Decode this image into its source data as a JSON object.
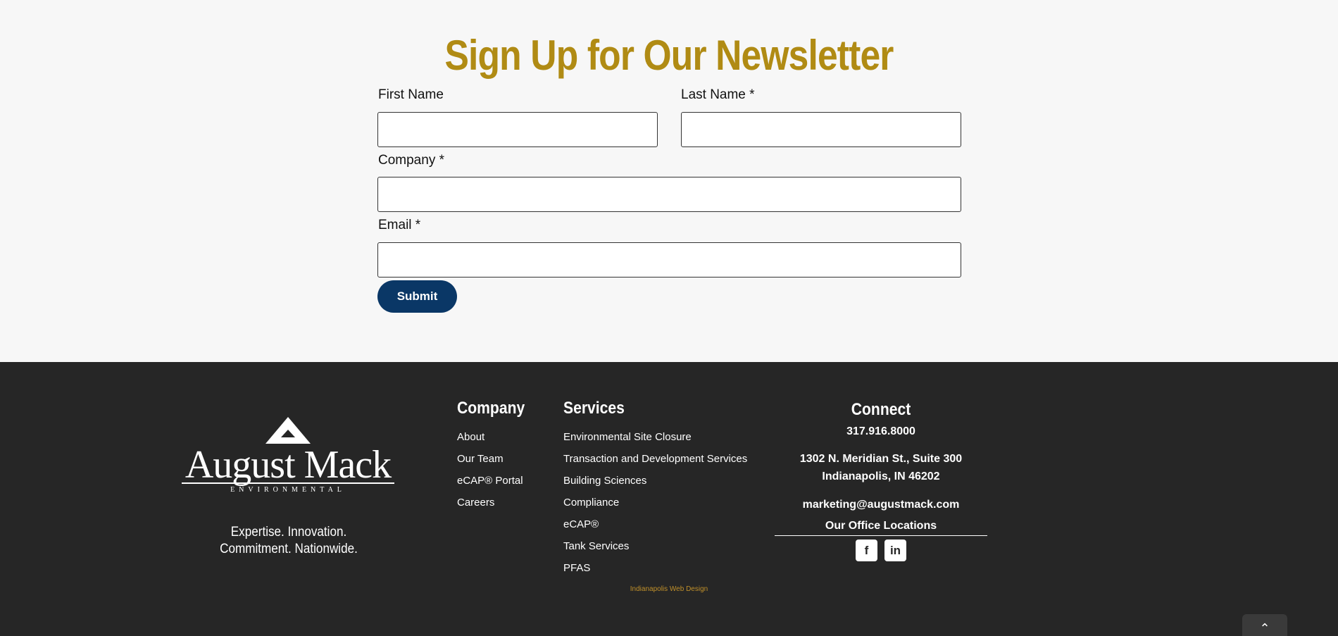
{
  "newsletter": {
    "title": "Sign Up for Our Newsletter",
    "first_name_label": "First Name",
    "last_name_label": "Last Name *",
    "company_label": "Company *",
    "email_label": "Email *",
    "first_name_value": "",
    "last_name_value": "",
    "company_value": "",
    "email_value": "",
    "submit_label": "Submit",
    "title_color": "#b08b14",
    "button_color": "#0a3766"
  },
  "footer": {
    "logo": {
      "name": "August Mack",
      "sub": "ENVIRONMENTAL"
    },
    "tagline_line1": "Expertise. Innovation.",
    "tagline_line2": "Commitment. Nationwide.",
    "company": {
      "heading": "Company",
      "items": [
        "About",
        "Our Team",
        "eCAP® Portal",
        "Careers"
      ]
    },
    "services": {
      "heading": "Services",
      "items": [
        "Environmental Site Closure",
        "Transaction and Development Services",
        "Building Sciences",
        "Compliance",
        "eCAP®",
        "Tank Services",
        "PFAS"
      ]
    },
    "connect": {
      "heading": "Connect",
      "phone": "317.916.8000",
      "address_line1": "1302 N. Meridian St., Suite 300",
      "address_line2": "Indianapolis, IN 46202",
      "email": "marketing@augustmack.com",
      "office_link": "Our Office Locations",
      "social": [
        {
          "icon": "facebook-icon",
          "glyph": "f"
        },
        {
          "icon": "linkedin-icon",
          "glyph": "in"
        }
      ]
    },
    "credit": "Indianapolis Web Design",
    "background": "#262626"
  }
}
